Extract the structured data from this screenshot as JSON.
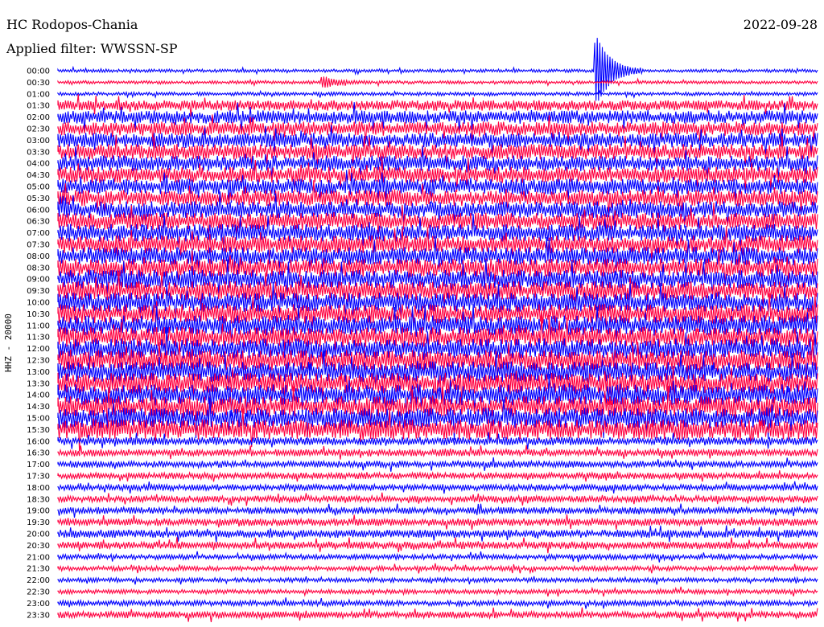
{
  "header": {
    "station": "HC Rodopos-Chania",
    "date": "2022-09-28",
    "filter": "Applied filter: WWSSN-SP"
  },
  "chart_data": {
    "type": "line",
    "title": "HC Rodopos-Chania",
    "subtitle": "Applied filter: WWSSN-SP",
    "date": "2022-09-28",
    "ylabel": "HHZ - 20000",
    "xlabel": "",
    "line_labels": [
      "00:00",
      "00:30",
      "01:00",
      "01:30",
      "02:00",
      "02:30",
      "03:00",
      "03:30",
      "04:00",
      "04:30",
      "05:00",
      "05:30",
      "06:00",
      "06:30",
      "07:00",
      "07:30",
      "08:00",
      "08:30",
      "09:00",
      "09:30",
      "10:00",
      "10:30",
      "11:00",
      "11:30",
      "12:00",
      "12:30",
      "13:00",
      "13:30",
      "14:00",
      "14:30",
      "15:00",
      "15:30",
      "16:00",
      "16:30",
      "17:00",
      "17:30",
      "18:00",
      "18:30",
      "19:00",
      "19:30",
      "20:00",
      "20:30",
      "21:00",
      "21:30",
      "22:00",
      "22:30",
      "23:00",
      "23:30"
    ],
    "trace_colors": [
      "#0000ff",
      "#ff0040"
    ],
    "relative_noise_amplitude": [
      1.0,
      1.0,
      1.1,
      3.2,
      4.2,
      4.4,
      4.6,
      4.8,
      4.9,
      5.0,
      5.0,
      5.1,
      5.2,
      5.3,
      5.4,
      5.5,
      5.6,
      5.7,
      5.8,
      5.9,
      6.0,
      6.1,
      6.2,
      6.3,
      6.3,
      6.4,
      6.4,
      6.5,
      6.5,
      6.4,
      6.4,
      6.3,
      2.6,
      2.2,
      2.1,
      2.0,
      2.0,
      2.0,
      2.1,
      2.3,
      2.5,
      2.3,
      1.6,
      1.5,
      1.4,
      1.4,
      1.7,
      2.1
    ],
    "events": [
      {
        "line": "00:00",
        "fraction_of_line": 0.71,
        "relative_amplitude": 40
      },
      {
        "line": "00:30",
        "fraction_of_line": 0.35,
        "relative_amplitude": 6
      }
    ],
    "grid": false,
    "legend": "none"
  }
}
